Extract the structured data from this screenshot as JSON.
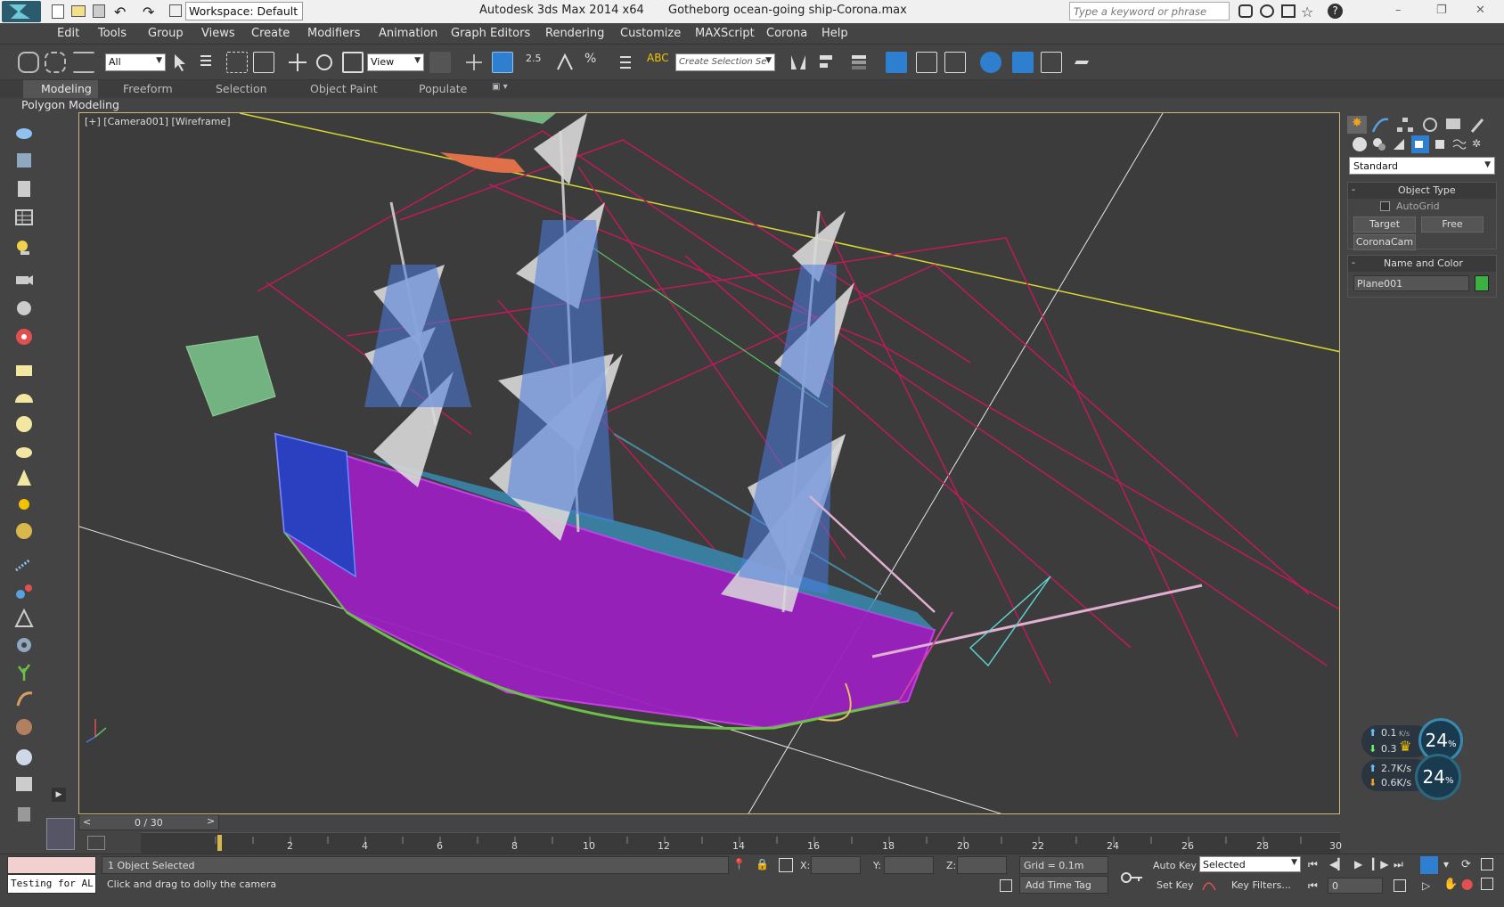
{
  "titlebar": {
    "workspace_label": "Workspace: Default",
    "app_title": "Autodesk 3ds Max  2014 x64",
    "file_title": "Gotheborg ocean-going ship-Corona.max",
    "search_placeholder": "Type a keyword or phrase"
  },
  "menubar": {
    "items": [
      "Edit",
      "Tools",
      "Group",
      "Views",
      "Create",
      "Modifiers",
      "Animation",
      "Graph Editors",
      "Rendering",
      "Customize",
      "MAXScript",
      "Corona",
      "Help"
    ]
  },
  "toolbar": {
    "selection_filter": "All",
    "reference_coord": "View",
    "snap_label": "2.5",
    "create_selection_set": "Create Selection Se"
  },
  "ribbon": {
    "tabs": [
      "Modeling",
      "Freeform",
      "Selection",
      "Object Paint",
      "Populate"
    ],
    "active_tab": "Modeling",
    "panel_label": "Polygon Modeling"
  },
  "viewport": {
    "label": "[+] [Camera001] [Wireframe]"
  },
  "command_panel": {
    "category": "Standard",
    "object_type_header": "Object Type",
    "autogrid_label": "AutoGrid",
    "buttons": [
      "Target",
      "Free",
      "CoronaCam"
    ],
    "name_color_header": "Name and Color",
    "object_name": "Plane001",
    "object_color": "#3cb043"
  },
  "timeline": {
    "frame_display": "0 / 30",
    "ticks": [
      "2",
      "4",
      "6",
      "8",
      "10",
      "12",
      "14",
      "16",
      "18",
      "20",
      "22",
      "24",
      "26",
      "28",
      "30"
    ]
  },
  "status": {
    "script_listener": "Testing for AL",
    "selection_status": "1 Object Selected",
    "prompt": "Click and drag to dolly the camera",
    "x_label": "X:",
    "y_label": "Y:",
    "z_label": "Z:",
    "grid": "Grid = 0.1m",
    "add_time_tag": "Add Time Tag",
    "auto_key": "Auto Key",
    "set_key": "Set Key",
    "selected_dropdown": "Selected",
    "key_filters": "Key Filters...",
    "frame_value": "0"
  },
  "network_widget": {
    "up_speed": "0.1",
    "up_unit": "K/s",
    "down_speed": "0.3",
    "up2": "2.7K/s",
    "down2": "0.6K/s",
    "cpu_percent": "24",
    "mem_percent": "24",
    "percent_sign": "%"
  },
  "colors": {
    "accent_blue": "#2f7fd0",
    "viewport_border": "#c9b87a",
    "hull": "#b030d0"
  }
}
